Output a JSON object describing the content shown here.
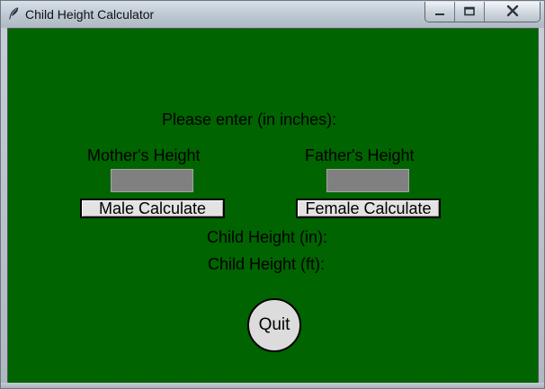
{
  "window": {
    "title": "Child Height Calculator",
    "icons": {
      "app": "feather-icon",
      "minimize": "minimize-icon",
      "maximize": "maximize-icon",
      "close": "close-icon"
    }
  },
  "form": {
    "prompt": "Please enter (in inches):",
    "mother_label": "Mother's Height",
    "father_label": "Father's Height",
    "mother_value": "",
    "father_value": "",
    "male_button": "Male Calculate",
    "female_button": "Female Calculate",
    "result_in_label": "Child Height (in):",
    "result_ft_label": "Child Height (ft):",
    "quit_button": "Quit"
  },
  "colors": {
    "background": "#006400",
    "field": "#808080",
    "button": "#e3e3e3",
    "quit": "#dcdcdc"
  }
}
